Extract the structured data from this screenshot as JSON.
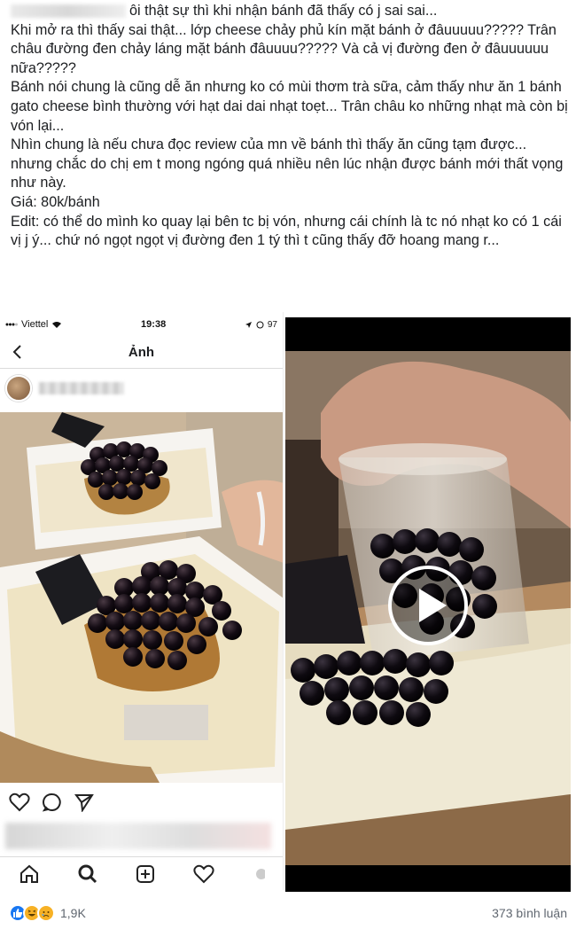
{
  "post": {
    "lines": [
      "ôi thật sự thì khi nhận bánh đã thấy có j sai sai...",
      "Khi mở ra thì thấy sai thật... lớp cheese chảy phủ kín mặt bánh ở đâuuuuu????? Trân châu đường đen chảy láng mặt bánh đâuuuu????? Và cả vị đường đen ở đâuuuuuu nữa?????",
      "Bánh nói chung là cũng dễ ăn nhưng ko có mùi thơm trà sữa, cảm thấy như ăn 1 bánh gato cheese bình thường với hạt dai dai nhạt toẹt... Trân châu ko những nhạt mà còn bị vón lại...",
      "Nhìn chung là nếu chưa đọc review của mn về bánh thì thấy ăn cũng tạm được... nhưng chắc do chị em t mong ngóng quá nhiều nên lúc nhận được bánh mới thất vọng như này.",
      "Giá: 80k/bánh",
      "Edit: có thể do mình ko quay lại bên tc bị vón, nhưng cái chính là tc nó nhạt ko có 1 cái vị j ý... chứ nó ngọt ngọt vị đường đen 1 tý thì t cũng thấy đỡ hoang mang r..."
    ]
  },
  "phone": {
    "carrier": "Viettel",
    "time": "19:38",
    "battery": "97",
    "title": "Ảnh"
  },
  "footer": {
    "reaction_count": "1,9K",
    "comments": "373 bình luận"
  },
  "colors": {
    "like": "#1877f2",
    "reaction_yellow": "#f7b125",
    "text": "#1c1e21",
    "muted": "#606770"
  },
  "icons": [
    "back-icon",
    "heart-icon",
    "comment-icon",
    "share-icon",
    "home-icon",
    "search-icon",
    "add-icon",
    "activity-icon",
    "play-icon",
    "like-reaction-icon",
    "haha-reaction-icon",
    "sad-reaction-icon"
  ]
}
